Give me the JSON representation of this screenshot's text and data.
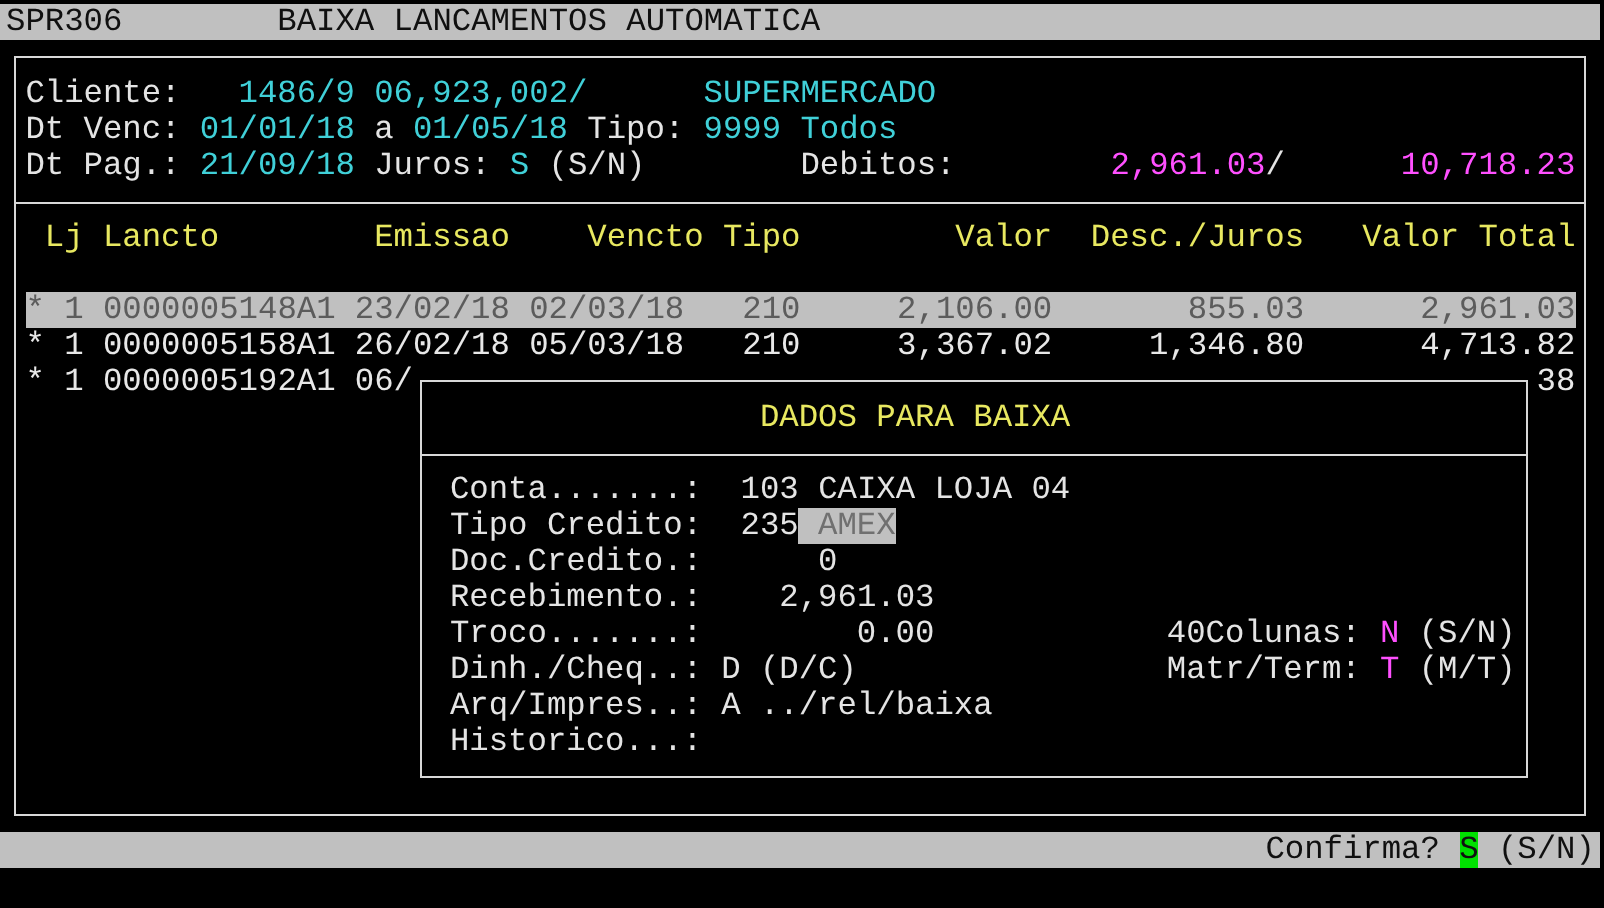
{
  "title_bar": {
    "program": "SPR306",
    "title": "BAIXA LANCAMENTOS AUTOMATICA"
  },
  "cliente": {
    "label": "Cliente:",
    "code": "1486/9",
    "document": "06,923,002/",
    "name": "SUPERMERCADO"
  },
  "vencimento": {
    "label": "Dt Venc:",
    "from": "01/01/18",
    "separator": "a",
    "to": "01/05/18",
    "tipo_label": "Tipo:",
    "tipo_code": "9999",
    "tipo_name": "Todos"
  },
  "pagamento": {
    "label": "Dt Pag.:",
    "date": "21/09/18",
    "juros_label": "Juros:",
    "juros": "S",
    "juros_options": "(S/N)",
    "debitos_label": "Debitos:",
    "debitos": "2,961.03",
    "debitos_separator": "/",
    "debitos_total": "10,718.23"
  },
  "table": {
    "columns": [
      "Lj",
      "Lancto",
      "Emissao",
      "Vencto",
      "Tipo",
      "Valor",
      "Desc./Juros",
      "Valor Total"
    ],
    "rows": [
      {
        "marker": "*",
        "selected": true,
        "cells": [
          "1",
          "0000005148A1",
          "23/02/18",
          "02/03/18",
          "210",
          "2,106.00",
          "855.03",
          "2,961.03"
        ]
      },
      {
        "marker": "*",
        "selected": false,
        "cells": [
          "1",
          "0000005158A1",
          "26/02/18",
          "05/03/18",
          "210",
          "3,367.02",
          "1,346.80",
          "4,713.82"
        ]
      },
      {
        "marker": "*",
        "selected": false,
        "cells": [
          "1",
          "0000005192A1",
          "06/",
          null,
          null,
          null,
          null,
          "38"
        ]
      }
    ]
  },
  "dialog": {
    "title": "DADOS PARA BAIXA",
    "fields": [
      {
        "label": "Conta.......:",
        "value": "103 CAIXA LOJA 04"
      },
      {
        "label": "Tipo Credito:",
        "value": "235",
        "lookup": "AMEX"
      },
      {
        "label": "Doc.Credito.:",
        "value": "0"
      },
      {
        "label": "Recebimento.:",
        "value": "2,961.03"
      },
      {
        "label": "Troco.......:",
        "value": "0.00",
        "option": {
          "label": "40Colunas:",
          "value": "N",
          "choices": "(S/N)"
        }
      },
      {
        "label": "Dinh./Cheq..:",
        "value": "D",
        "hint": "(D/C)",
        "option": {
          "label": "Matr/Term:",
          "value": "T",
          "choices": "(M/T)"
        }
      },
      {
        "label": "Arq/Impres..:",
        "value": "A",
        "hint": "../rel/baixa"
      },
      {
        "label": "Historico...:"
      }
    ]
  },
  "status_bar": {
    "prompt": "Confirma?",
    "answer": "S",
    "options": "(S/N)"
  }
}
